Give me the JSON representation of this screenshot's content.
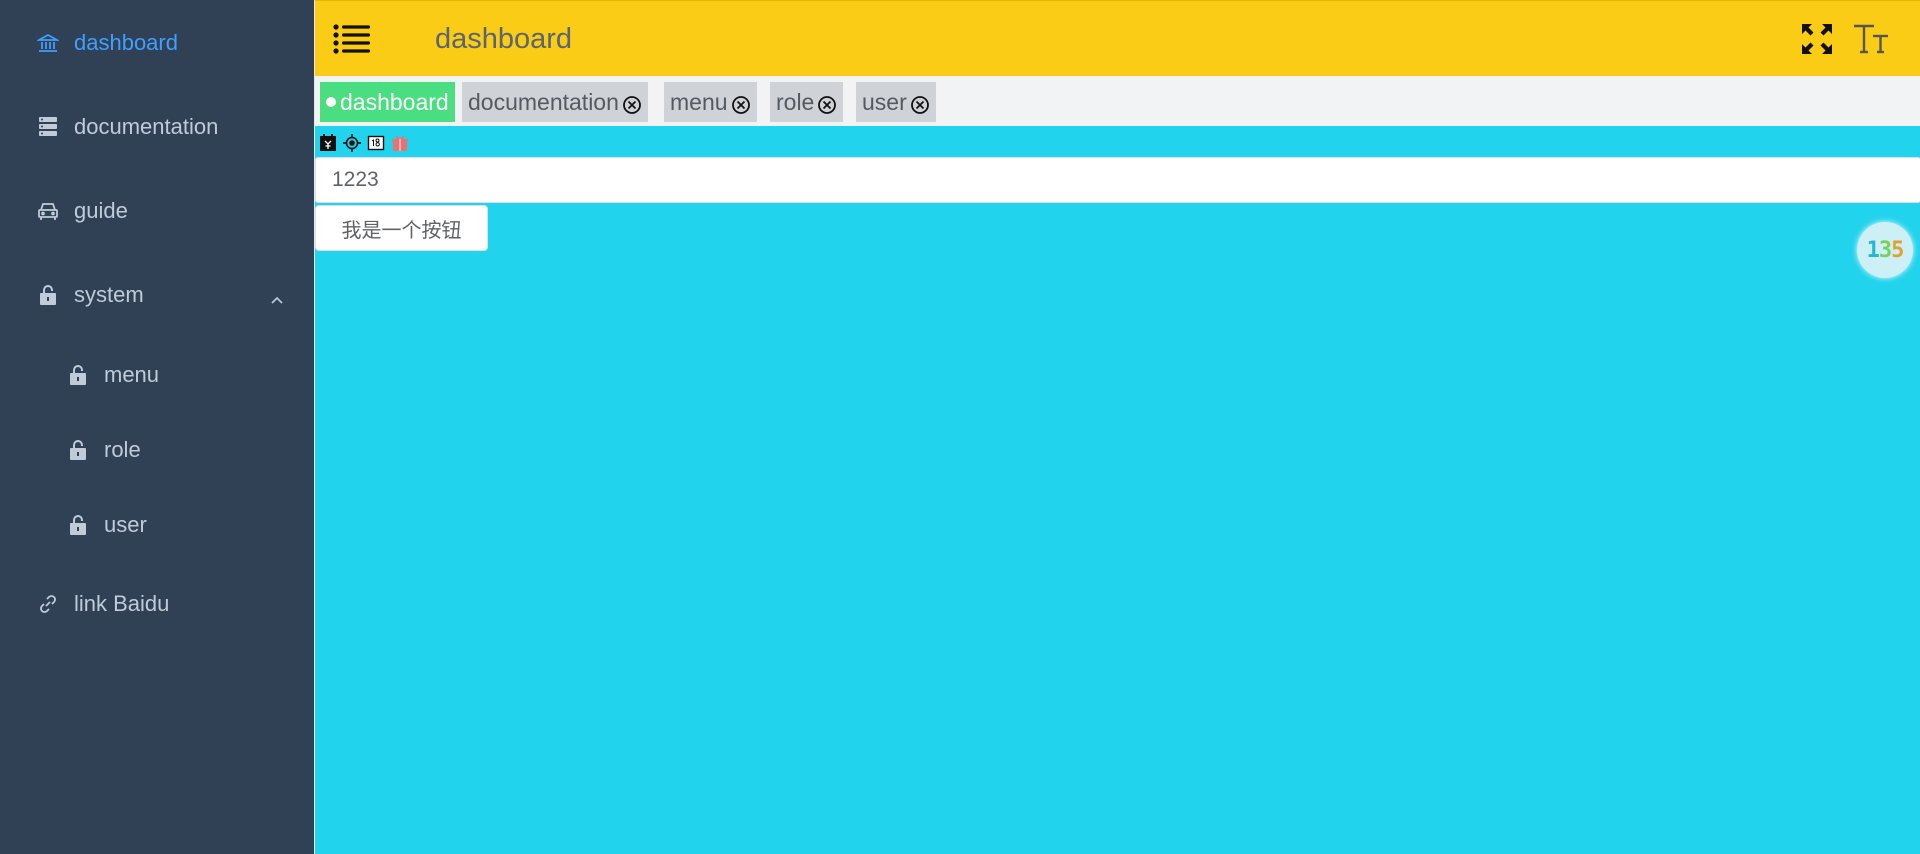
{
  "sidebar": {
    "items": [
      {
        "label": "dashboard",
        "icon": "bank-icon",
        "active": true
      },
      {
        "label": "documentation",
        "icon": "database-icon"
      },
      {
        "label": "guide",
        "icon": "car-icon"
      },
      {
        "label": "system",
        "icon": "lock-icon",
        "expanded": true
      },
      {
        "label": "menu",
        "icon": "lock-icon"
      },
      {
        "label": "role",
        "icon": "lock-icon"
      },
      {
        "label": "user",
        "icon": "lock-icon"
      },
      {
        "label": "link Baidu",
        "icon": "link-icon"
      }
    ]
  },
  "navbar": {
    "title": "dashboard"
  },
  "tags": [
    {
      "label": "dashboard",
      "active": true
    },
    {
      "label": "documentation"
    },
    {
      "label": "menu"
    },
    {
      "label": "role"
    },
    {
      "label": "user"
    }
  ],
  "form": {
    "input_value": "1223",
    "button_label": "我是一个按钮"
  },
  "badge": {
    "d1": "1",
    "d2": "3",
    "d3": "5"
  },
  "colors": {
    "sidebar_bg": "#304156",
    "sidebar_text": "#bfcbd9",
    "active_text": "#409eff",
    "navbar_bg": "#facc15",
    "content_bg": "#22d3ee",
    "active_tag": "#4ade80"
  }
}
